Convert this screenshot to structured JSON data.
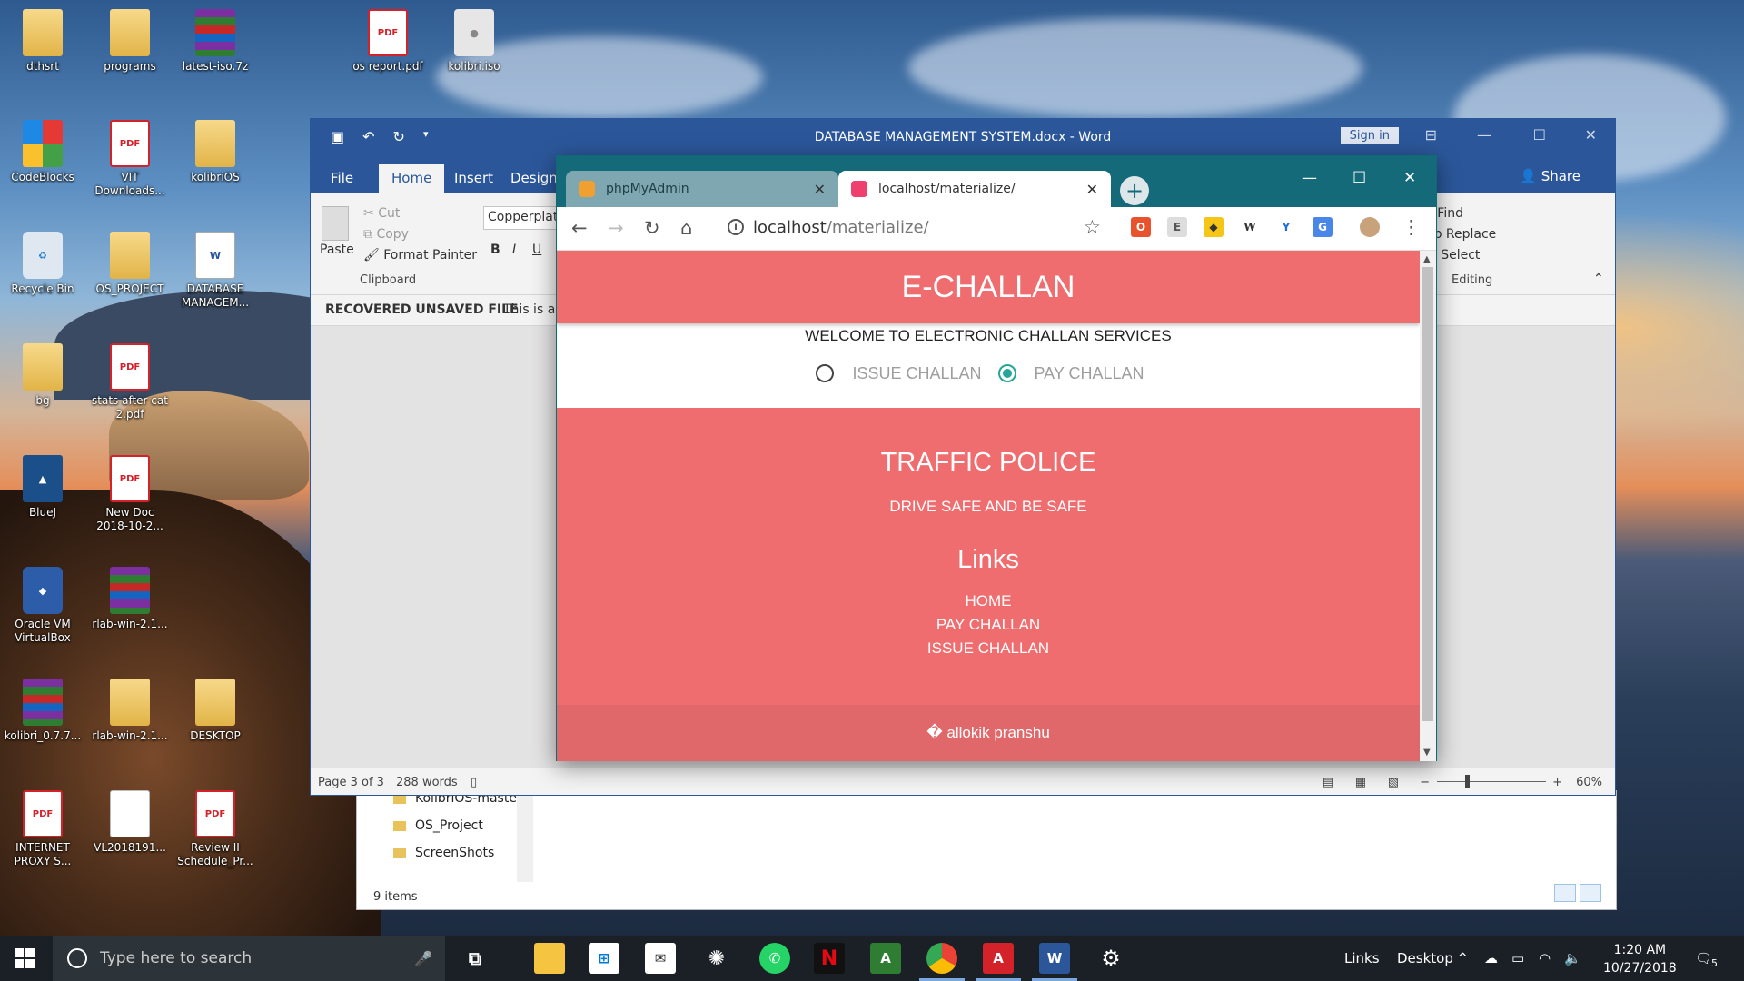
{
  "desktop": {
    "icons": [
      {
        "label": "dthsrt",
        "glyph": "folder"
      },
      {
        "label": "programs",
        "glyph": "folder"
      },
      {
        "label": "latest-iso.7z",
        "glyph": "rar"
      },
      {
        "label": "os report.pdf",
        "glyph": "pdf"
      },
      {
        "label": "kolibri.iso",
        "glyph": "iso"
      },
      {
        "label": "CodeBlocks",
        "glyph": "codeblocks"
      },
      {
        "label": "VIT\nDownloads...",
        "glyph": "pdf"
      },
      {
        "label": "kolibriOS",
        "glyph": "folder"
      },
      {
        "label": "Recycle Bin",
        "glyph": "recycle-bin"
      },
      {
        "label": "OS_PROJECT",
        "glyph": "folder"
      },
      {
        "label": "DATABASE\nMANAGEM...",
        "glyph": "word-doc"
      },
      {
        "label": "bg",
        "glyph": "folder"
      },
      {
        "label": "stats after cat\n2.pdf",
        "glyph": "pdf"
      },
      {
        "label": "BlueJ",
        "glyph": "bluej"
      },
      {
        "label": "New Doc\n2018-10-2...",
        "glyph": "pdf"
      },
      {
        "label": "Oracle VM\nVirtualBox",
        "glyph": "virtualbox"
      },
      {
        "label": "rlab-win-2.1...",
        "glyph": "rar"
      },
      {
        "label": "kolibri_0.7.7...",
        "glyph": "rar"
      },
      {
        "label": "rlab-win-2.1...",
        "glyph": "folder"
      },
      {
        "label": "DESKTOP",
        "glyph": "folder"
      },
      {
        "label": "INTERNET\nPROXY S...",
        "glyph": "pdf"
      },
      {
        "label": "VL2018191...",
        "glyph": "blank-doc"
      },
      {
        "label": "Review II\nSchedule_Pr...",
        "glyph": "pdf"
      }
    ]
  },
  "word": {
    "doc_title": "DATABASE MANAGEMENT SYSTEM.docx  -  Word",
    "sign_in": "Sign in",
    "tabs": [
      "File",
      "Home",
      "Insert",
      "Design"
    ],
    "active_tab": "Home",
    "share": "Share",
    "clipboard": {
      "paste": "Paste",
      "cut": "Cut",
      "copy": "Copy",
      "format_painter": "Format Painter",
      "group": "Clipboard"
    },
    "font_name": "Copperplat",
    "font_buttons": [
      "B",
      "I",
      "U"
    ],
    "editing": {
      "find": "Find",
      "replace": "Replace",
      "select": "Select",
      "group": "Editing"
    },
    "notice_title": "RECOVERED UNSAVED FILE",
    "notice_text": "This is a",
    "status": {
      "page": "Page 3 of 3",
      "words": "288 words",
      "zoom": "60%"
    }
  },
  "explorer": {
    "items": [
      "KolibriOS-maste",
      "OS_Project",
      "ScreenShots"
    ],
    "count": "9 items"
  },
  "chrome": {
    "tabs": [
      {
        "title": "phpMyAdmin",
        "active": false
      },
      {
        "title": "localhost/materialize/",
        "active": true
      }
    ],
    "url_host": "localhost",
    "url_path": "/materialize/",
    "extensions": [
      "office-icon",
      "evernote-icon",
      "keep-icon",
      "wikipedia-icon",
      "vpn-icon",
      "translate-icon",
      "profile-avatar"
    ]
  },
  "page": {
    "brand": "E-CHALLAN",
    "welcome": "WELCOME TO ELECTRONIC CHALLAN SERVICES",
    "radios": [
      {
        "label": "ISSUE CHALLAN",
        "checked": false
      },
      {
        "label": "PAY CHALLAN",
        "checked": true
      }
    ],
    "footer_title": "TRAFFIC POLICE",
    "footer_subtitle": "DRIVE SAFE AND BE SAFE",
    "links_title": "Links",
    "links": [
      "HOME",
      "PAY CHALLAN",
      "ISSUE CHALLAN"
    ],
    "copyright": "� allokik pranshu",
    "colors": {
      "primary": "#ef6d6f",
      "radio_accent": "#26a69a"
    }
  },
  "taskbar": {
    "search_placeholder": "Type here to search",
    "apps": [
      "file-explorer-icon",
      "store-icon",
      "mail-icon",
      "spider-solitaire-icon",
      "whatsapp-icon",
      "netflix-icon",
      "android-studio-icon",
      "chrome-icon",
      "acrobat-icon",
      "word-icon",
      "settings-icon"
    ],
    "tray": {
      "links": "Links",
      "desktop": "Desktop",
      "time": "1:20 AM",
      "date": "10/27/2018",
      "notifications": "5"
    }
  }
}
